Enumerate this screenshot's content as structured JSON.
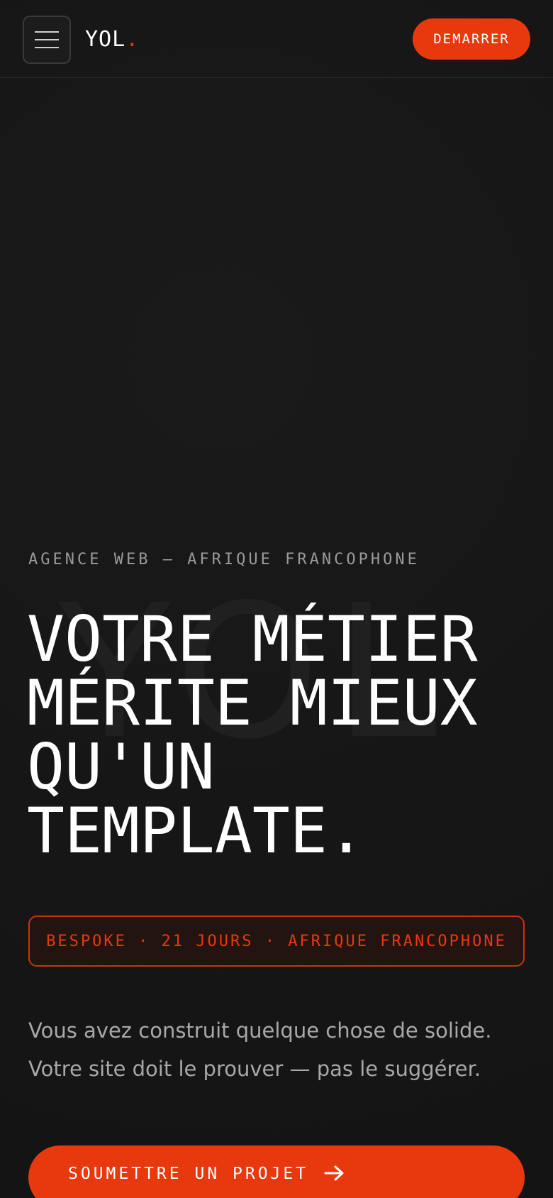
{
  "header": {
    "logo_text": "YOL",
    "logo_dot": ".",
    "cta_label": "DEMARRER"
  },
  "hero": {
    "eyebrow": "AGENCE WEB — AFRIQUE FRANCOPHONE",
    "watermark": "YOL",
    "headline_lines": [
      "VOTRE MÉTIER",
      "MÉRITE MIEUX",
      "QU'UN",
      "TEMPLATE."
    ],
    "tagline": "BESPOKE · 21 JOURS · AFRIQUE FRANCOPHONE",
    "intro_lines": [
      "Vous avez construit quelque chose de solide.",
      "Votre site doit le prouver — pas le suggérer."
    ],
    "cta_label": "SOUMETTRE UN PROJET"
  },
  "icons": {
    "menu": "hamburger-menu-icon",
    "cta_arrow": "arrow-right-icon"
  },
  "colors": {
    "background": "#161616",
    "accent": "#e8380e",
    "text": "#ffffff",
    "muted": "#9a9a9a"
  }
}
